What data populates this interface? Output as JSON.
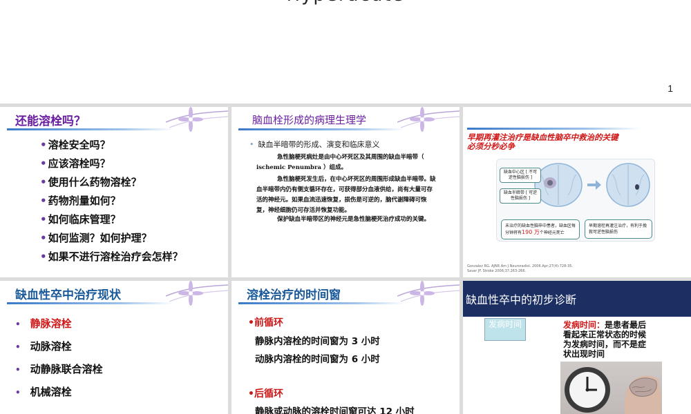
{
  "top": {
    "title": "Hyperacute",
    "page_number": "1"
  },
  "slide1": {
    "title": "还能溶栓吗？",
    "bullet": "•",
    "questions": [
      "溶栓安全吗？",
      "应该溶栓吗？",
      "使用什么药物溶栓？",
      "药物剂量如何？",
      "如何临床管理？",
      "如何监测？如何护理？",
      "如果不进行溶栓治疗会怎样？"
    ]
  },
  "slide2": {
    "title": "脑血栓形成的病理生理学",
    "subheading": "缺血半暗带的形成、演变和临床意义",
    "paragraphs": [
      "急性脑梗死病灶是由中心坏死区及其周围的缺血半暗带（ ischemic Penumbra ）组成。",
      "急性脑梗死发生后，在中心坏死区的周围形成缺血半暗带。缺血半暗带内仍有侧支循环存在，可获得部分血液供给，尚有大量可存活的神经元。如果血流迅速恢复，损伤是可逆的，脑代谢障碍可恢复，神经细胞仍可存活并恢复功能。",
      "保护缺血半暗带区的神经元是急性脑梗死治疗成功的关键。"
    ]
  },
  "slide3": {
    "title_line1": "早期再灌注治疗是缺血性脑卒中救治的关键",
    "title_line2": "必须分秒必争",
    "label_core": "缺血中心区 [ 不可逆性脑损伤 ]",
    "label_penumbra": "缺血半暗带 [ 可逆性脑损伤 ]",
    "note_left_pre": "未治疗的缺血性脑卒中患者，缺血区每分钟将有",
    "note_left_number": "190 万",
    "note_left_post": "个神经元死亡",
    "note_right": "早期溶栓再灌注治疗，有利于挽救可逆性脑损伤",
    "refs": [
      "Gonzalez RG. AJNR Am J Neuroradiol. 2006 Apr;27(4):728-35.",
      "Saver JF. Stroke 2006;37:263-266."
    ]
  },
  "slide4": {
    "title": "缺血性卒中治疗现状",
    "bullet": "•",
    "items": [
      "静脉溶栓",
      "动脉溶栓",
      "动静脉联合溶栓",
      "机械溶栓"
    ]
  },
  "slide5": {
    "title": "溶栓治疗的时间窗",
    "section1": "•前循环",
    "line1": "静脉内溶栓的时间窗为 3 小时",
    "line2": "动脉内溶栓的时间窗为 6 小时",
    "section2": "•后循环",
    "line3": "静脉或动脉的溶栓时间窗可达 12 小时"
  },
  "slide6": {
    "banner": "缺血性卒中的初步诊断",
    "onset_box": "发病时间",
    "desc_red": "发病时间：",
    "desc_rest": "是患者最后看起来正常状态的时候为发病时间，而不是症状出现时间"
  },
  "colors": {
    "purple_title": "#6a1fa0",
    "blue_title": "#1a5a9a",
    "red": "#d01818",
    "navy_banner": "#1c2f63"
  }
}
